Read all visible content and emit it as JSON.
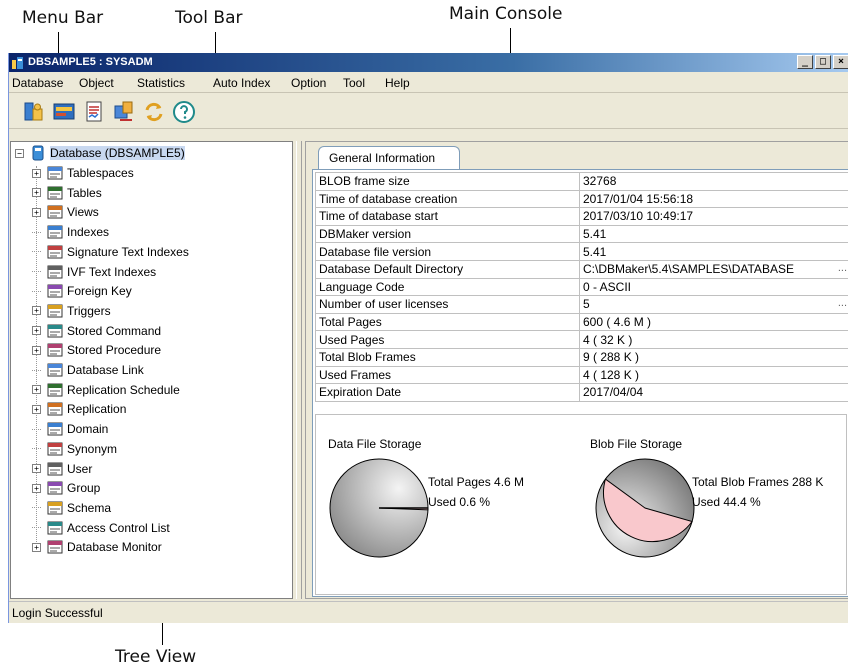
{
  "callouts": {
    "menu_bar": "Menu Bar",
    "tool_bar": "Tool Bar",
    "main_console": "Main Console",
    "tree_view": "Tree View"
  },
  "window": {
    "title": "DBSAMPLE5 : SYSADM",
    "minimize": "_",
    "maximize": "□",
    "close": "×"
  },
  "menu": {
    "items": [
      "Database",
      "Object",
      "Statistics",
      "Auto Index",
      "Option",
      "Tool",
      "Help"
    ]
  },
  "toolbar": {
    "icons": [
      "database-connect-icon",
      "console-icon",
      "report-icon",
      "export-icon",
      "refresh-icon",
      "help-icon"
    ]
  },
  "tree": {
    "root": "Database (DBSAMPLE5)",
    "items": [
      {
        "label": "Tablespaces",
        "expandable": true,
        "icon": "tablespaces-icon"
      },
      {
        "label": "Tables",
        "expandable": true,
        "icon": "tables-icon"
      },
      {
        "label": "Views",
        "expandable": true,
        "icon": "views-icon"
      },
      {
        "label": "Indexes",
        "expandable": false,
        "icon": "indexes-icon"
      },
      {
        "label": "Signature Text Indexes",
        "expandable": false,
        "icon": "signature-index-icon"
      },
      {
        "label": "IVF Text Indexes",
        "expandable": false,
        "icon": "ivf-index-icon"
      },
      {
        "label": "Foreign Key",
        "expandable": false,
        "icon": "foreign-key-icon"
      },
      {
        "label": "Triggers",
        "expandable": true,
        "icon": "triggers-icon"
      },
      {
        "label": "Stored Command",
        "expandable": true,
        "icon": "stored-command-icon"
      },
      {
        "label": "Stored Procedure",
        "expandable": true,
        "icon": "stored-procedure-icon"
      },
      {
        "label": "Database Link",
        "expandable": false,
        "icon": "database-link-icon"
      },
      {
        "label": "Replication Schedule",
        "expandable": true,
        "icon": "replication-schedule-icon"
      },
      {
        "label": "Replication",
        "expandable": true,
        "icon": "replication-icon"
      },
      {
        "label": "Domain",
        "expandable": false,
        "icon": "domain-icon"
      },
      {
        "label": "Synonym",
        "expandable": false,
        "icon": "synonym-icon"
      },
      {
        "label": "User",
        "expandable": true,
        "icon": "user-icon"
      },
      {
        "label": "Group",
        "expandable": true,
        "icon": "group-icon"
      },
      {
        "label": "Schema",
        "expandable": false,
        "icon": "schema-icon"
      },
      {
        "label": "Access Control List",
        "expandable": false,
        "icon": "access-control-icon"
      },
      {
        "label": "Database Monitor",
        "expandable": true,
        "icon": "database-monitor-icon"
      }
    ]
  },
  "main": {
    "tab": "General Information",
    "info": [
      {
        "key": "BLOB frame size",
        "value": "32768"
      },
      {
        "key": "Time of database creation",
        "value": "2017/01/04 15:56:18"
      },
      {
        "key": "Time of database start",
        "value": "2017/03/10 10:49:17"
      },
      {
        "key": "DBMaker version",
        "value": "5.41"
      },
      {
        "key": "Database file version",
        "value": "5.41"
      },
      {
        "key": "Database Default Directory",
        "value": "C:\\DBMaker\\5.4\\SAMPLES\\DATABASE",
        "more": "..."
      },
      {
        "key": "Language Code",
        "value": "0 - ASCII"
      },
      {
        "key": "Number of user licenses",
        "value": "5",
        "more": "..."
      },
      {
        "key": "Total Pages",
        "value": "600 ( 4.6 M )"
      },
      {
        "key": "Used Pages",
        "value": "4 ( 32 K )"
      },
      {
        "key": "Total Blob Frames",
        "value": "9 ( 288 K )"
      },
      {
        "key": "Used Frames",
        "value": "4 ( 128 K )"
      },
      {
        "key": "Expiration Date",
        "value": "2017/04/04"
      }
    ],
    "data_storage": {
      "title": "Data File Storage",
      "total_label": "Total Pages 4.6 M",
      "used_label": "Used 0.6 %",
      "used_percent": 0.6
    },
    "blob_storage": {
      "title": "Blob File Storage",
      "total_label": "Total Blob Frames 288 K",
      "used_label": "Used 44.4 %",
      "used_percent": 44.4
    }
  },
  "status": {
    "text": "Login Successful"
  },
  "colors": {
    "title_start": "#0a246a",
    "title_end": "#a6caf0",
    "selection": "#c8d8f0",
    "pie_used_blob": "#f9c8cc"
  }
}
